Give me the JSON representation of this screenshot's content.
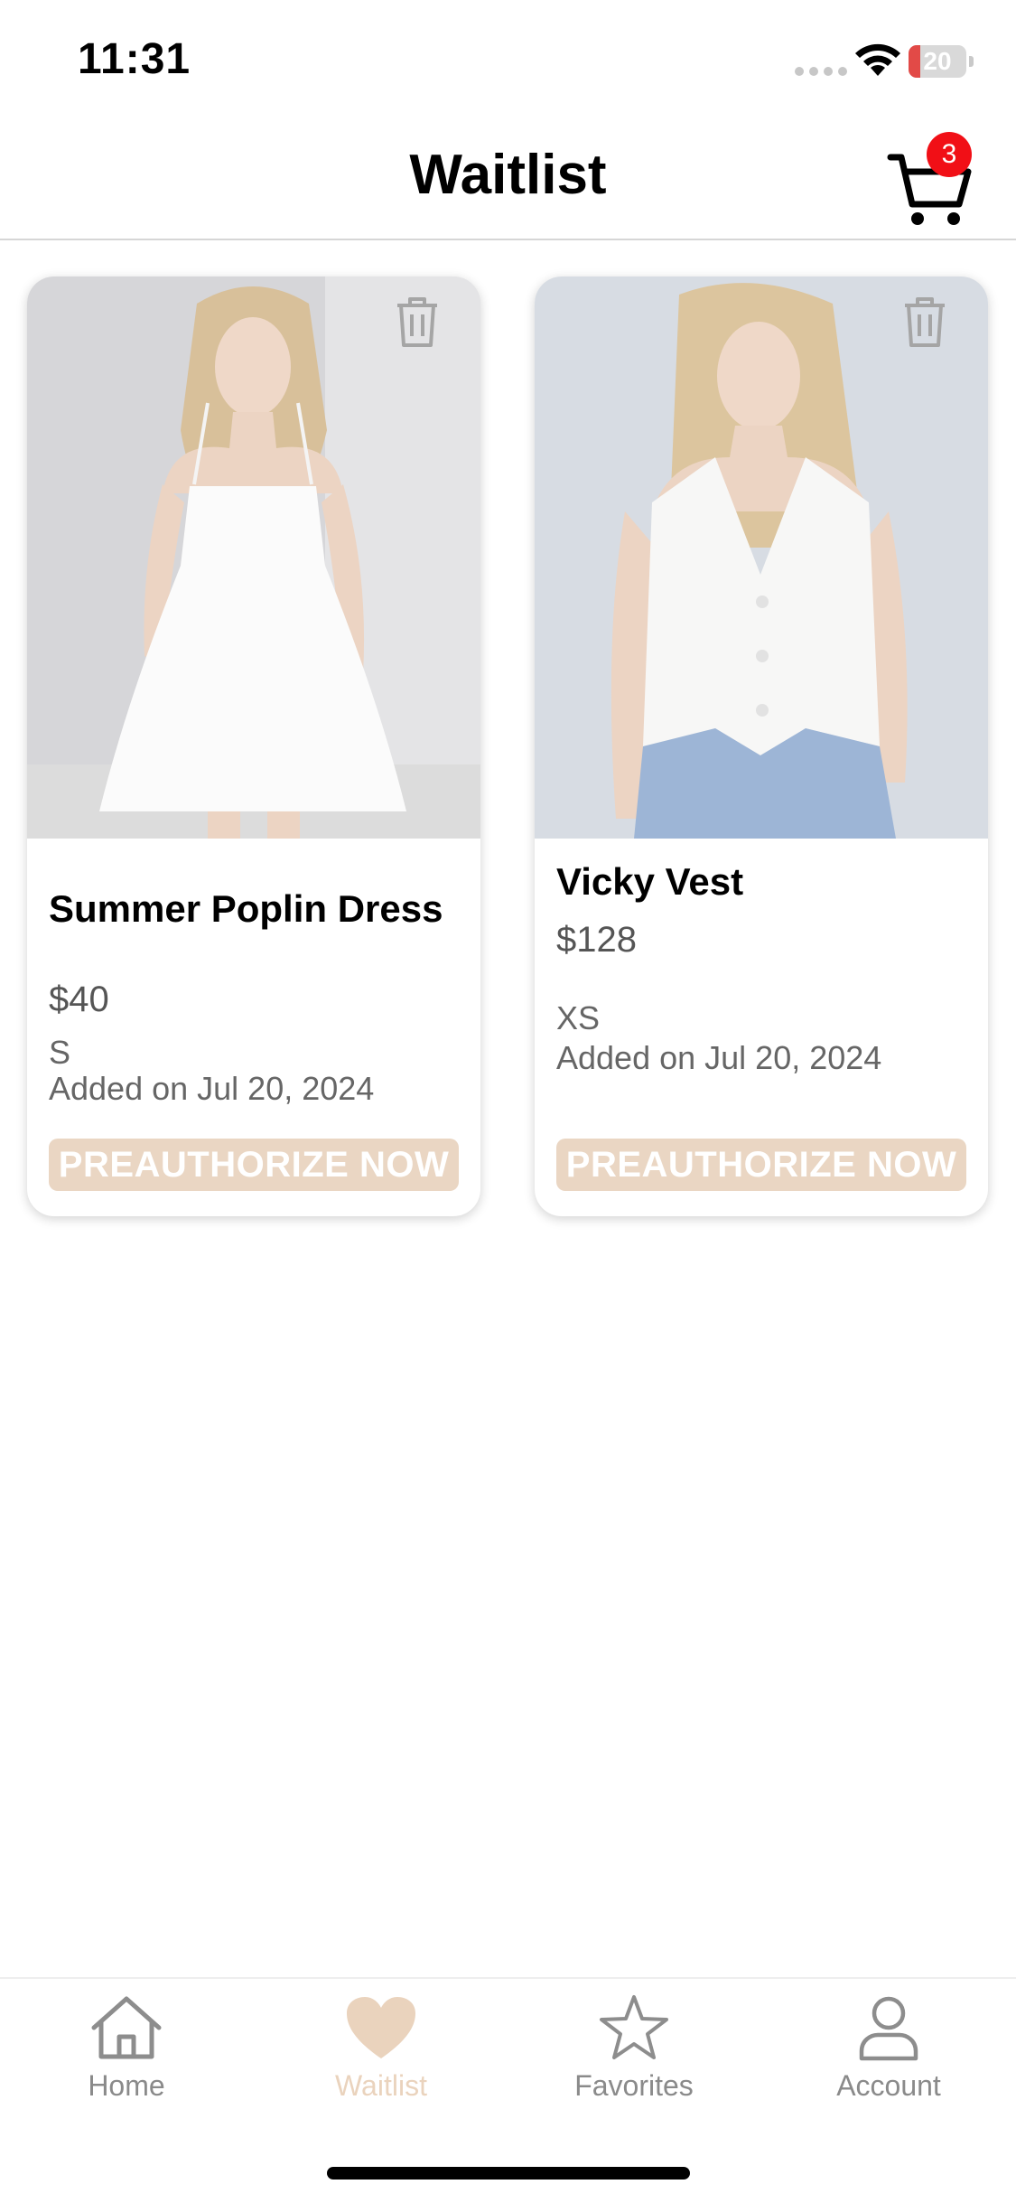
{
  "status_bar": {
    "time": "11:31",
    "battery_text": "20",
    "battery_level": 0.2,
    "battery_color": "#e24a47"
  },
  "header": {
    "title": "Waitlist",
    "cart_count": "3",
    "badge_color": "#f10f16"
  },
  "items": [
    {
      "name": "Summer Poplin Dress",
      "price": "$40",
      "size": "S",
      "added": "Added on Jul 20, 2024",
      "button_label": "PREAUTHORIZE NOW"
    },
    {
      "name": "Vicky Vest",
      "price": "$128",
      "size": "XS",
      "added": "Added on Jul 20, 2024",
      "button_label": "PREAUTHORIZE NOW"
    }
  ],
  "accent_color": "#ead6c3",
  "tabs": [
    {
      "label": "Home",
      "icon": "home-icon",
      "active": false
    },
    {
      "label": "Waitlist",
      "icon": "heart-icon",
      "active": true
    },
    {
      "label": "Favorites",
      "icon": "star-icon",
      "active": false
    },
    {
      "label": "Account",
      "icon": "person-icon",
      "active": false
    }
  ]
}
